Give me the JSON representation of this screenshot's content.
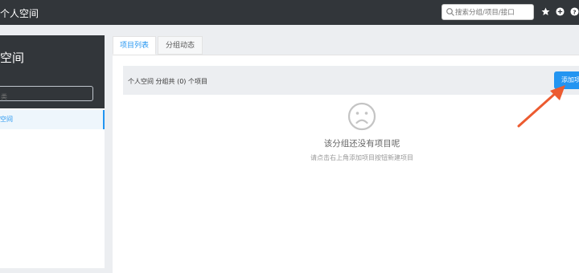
{
  "topbar": {
    "title": "个人空间",
    "search_placeholder": "搜索分组/项目/接口",
    "icons": [
      "star-icon",
      "plus-circle-icon",
      "help-icon"
    ]
  },
  "sidebar": {
    "group_name": "空间",
    "search_placeholder": "类",
    "items": [
      {
        "label": "空间"
      }
    ]
  },
  "tabs": [
    {
      "label": "项目列表",
      "active": true
    },
    {
      "label": "分组动态",
      "active": false
    }
  ],
  "main": {
    "summary": "个人空间 分组共 (0) 个项目",
    "add_button": "添加项",
    "empty_title": "该分组还没有项目呢",
    "empty_desc": "请点击右上角添加项目按钮新建项目"
  },
  "colors": {
    "header": "#32363a",
    "accent": "#2395f1",
    "annotation_arrow": "#ec5b30"
  }
}
